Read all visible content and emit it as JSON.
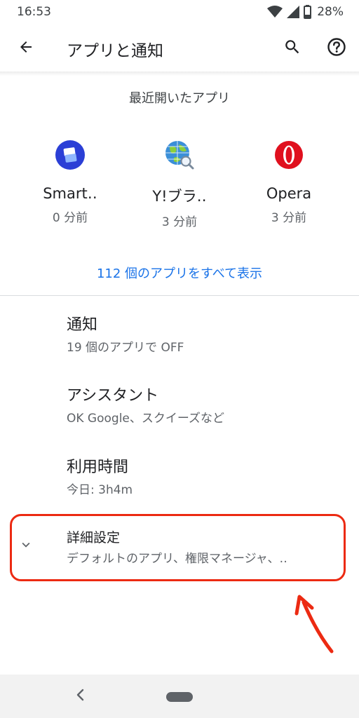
{
  "status_bar": {
    "time": "16:53",
    "battery": "28%",
    "icons": [
      "wifi-icon",
      "signal-icon",
      "battery-icon"
    ]
  },
  "toolbar": {
    "title": "アプリと通知",
    "back_icon": "arrow-back-icon",
    "search_icon": "search-icon",
    "help_icon": "help-icon"
  },
  "recent": {
    "header": "最近開いたアプリ",
    "apps": [
      {
        "name": "Smart‥",
        "time": "0 分前",
        "icon": "smart-launcher-icon"
      },
      {
        "name": "Y!ブラ‥",
        "time": "3 分前",
        "icon": "yahoo-browser-icon"
      },
      {
        "name": "Opera",
        "time": "3 分前",
        "icon": "opera-icon"
      }
    ],
    "see_all": "112 個のアプリをすべて表示"
  },
  "items": [
    {
      "title": "通知",
      "summary": "19 個のアプリで OFF"
    },
    {
      "title": "アシスタント",
      "summary": "OK Google、スクイーズなど"
    },
    {
      "title": "利用時間",
      "summary": "今日: 3h4m"
    }
  ],
  "advanced": {
    "title": "詳細設定",
    "summary": "デフォルトのアプリ、権限マネージャ、‥"
  },
  "colors": {
    "accent": "#1a73e8",
    "annotation": "#ec2a12"
  }
}
